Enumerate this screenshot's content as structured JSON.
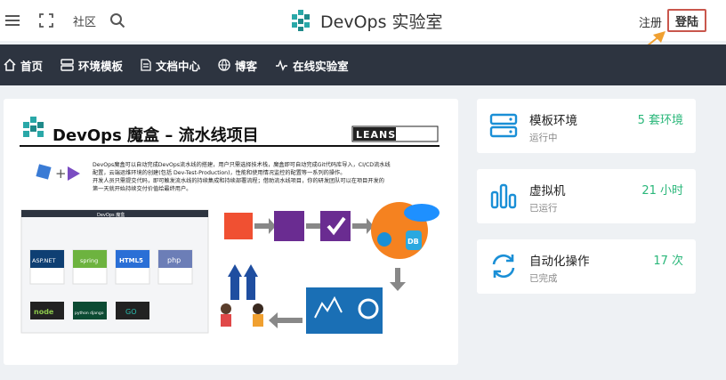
{
  "header": {
    "community": "社区",
    "brand": "DevOps 实验室",
    "register": "注册",
    "login": "登陆"
  },
  "nav": [
    {
      "label": "首页",
      "icon": "home-icon"
    },
    {
      "label": "环境模板",
      "icon": "server-icon"
    },
    {
      "label": "文档中心",
      "icon": "document-icon"
    },
    {
      "label": "博客",
      "icon": "globe-icon"
    },
    {
      "label": "在线实验室",
      "icon": "pulse-icon"
    }
  ],
  "banner": {
    "title": "DevOps 魔盒 – 流水线项目",
    "vendor": "LEANSOFT",
    "desc_line1": "DevOps魔盒可以自动完成DevOps流水线的搭建，用户只需选择技术栈，魔盒即可自动完成Git代码库导入，CI/CD流水线",
    "desc_line2": "配置，云端运维环境的创建(包括 Dev-Test-Production)，性能和使用情况监控的配置等一系列的操作。",
    "desc_line3": "开发人员只需提交代码，即可触发流水线的持续集成和持续部署流程；借助流水线项目，你的研发团队可以在项目开发的",
    "desc_line4": "第一天就开始持续交付价值给最终用户。",
    "mini_title": "DevOps 魔盒",
    "tech_tiles": [
      "ASP.NET",
      "spring",
      "HTML5",
      "php",
      "node",
      "python django",
      "GO"
    ],
    "db_label": "DB"
  },
  "stats": [
    {
      "name": "模板环境",
      "sub": "运行中",
      "value": "5 套环境",
      "icon": "server-icon"
    },
    {
      "name": "虚拟机",
      "sub": "已运行",
      "value": "21 小时",
      "icon": "bar-chart-icon"
    },
    {
      "name": "自动化操作",
      "sub": "已完成",
      "value": "17 次",
      "icon": "sync-icon"
    }
  ],
  "colors": {
    "accent": "#1a8fd6",
    "green": "#2ab77a",
    "navbar": "#2d3440",
    "login_border": "#c9574d",
    "arrow": "#f0a030"
  }
}
